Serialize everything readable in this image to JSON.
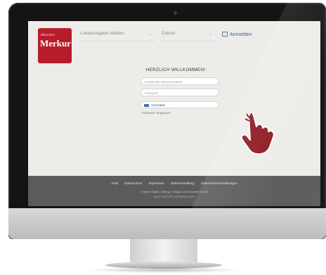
{
  "header": {
    "logo_top": "Münchner",
    "logo_main": "Merkur",
    "select_local": "Lokalausgabe wählen",
    "select_date": "Datum",
    "signin": "Anmelden"
  },
  "login": {
    "title": "HERZLICH WILLKOMMEN!",
    "email_placeholder": "E-Mail oder Benutzername",
    "password_placeholder": "Passwort",
    "button": "Anmelden",
    "forgot": "Passwort vergessen"
  },
  "footer": {
    "links": [
      "AGB",
      "Datenschutz",
      "Impressum",
      "Datenverwaltung",
      "Datenschutzeinstellungen"
    ],
    "copyright": "© Ippen Digital, Zeitung, Verlags und Druckerei GmbH",
    "note": "ALLE RECHTE VORBEHALTEN"
  },
  "colors": {
    "brand": "#b71c2b",
    "cursor": "#8e1a22",
    "footer_bg": "#5c5c5c"
  }
}
